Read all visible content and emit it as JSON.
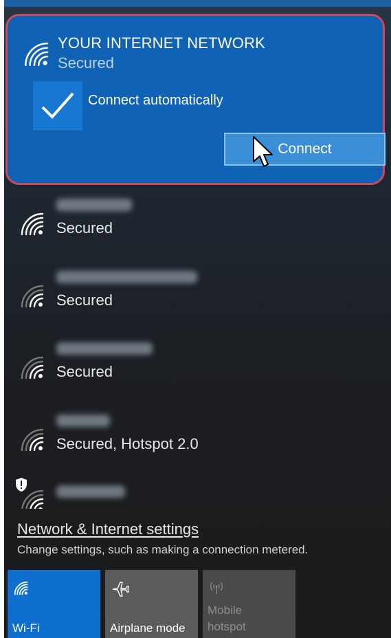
{
  "active_network": {
    "ssid": "YOUR INTERNET NETWORK",
    "status": "Secured",
    "connect_automatically_label": "Connect automatically",
    "connect_automatically_checked": true,
    "connect_button_label": "Connect"
  },
  "networks": [
    {
      "status": "Secured"
    },
    {
      "status": "Secured"
    },
    {
      "status": "Secured"
    },
    {
      "status": "Secured, Hotspot 2.0"
    },
    {
      "status": ""
    }
  ],
  "settings": {
    "link_label": "Network & Internet settings",
    "description": "Change settings, such as making a connection metered."
  },
  "quick_actions": [
    {
      "label": "Wi-Fi",
      "icon": "wifi-icon",
      "active": true
    },
    {
      "label": "Airplane mode",
      "icon": "airplane-icon",
      "active": false
    },
    {
      "label": "Mobile hotspot",
      "icon": "mobile-hotspot-icon",
      "active": false,
      "disabled": true
    }
  ],
  "colors": {
    "accent": "#0f62b4",
    "highlight_border": "#c94a5d",
    "panel_bg": "#1c1f24"
  }
}
